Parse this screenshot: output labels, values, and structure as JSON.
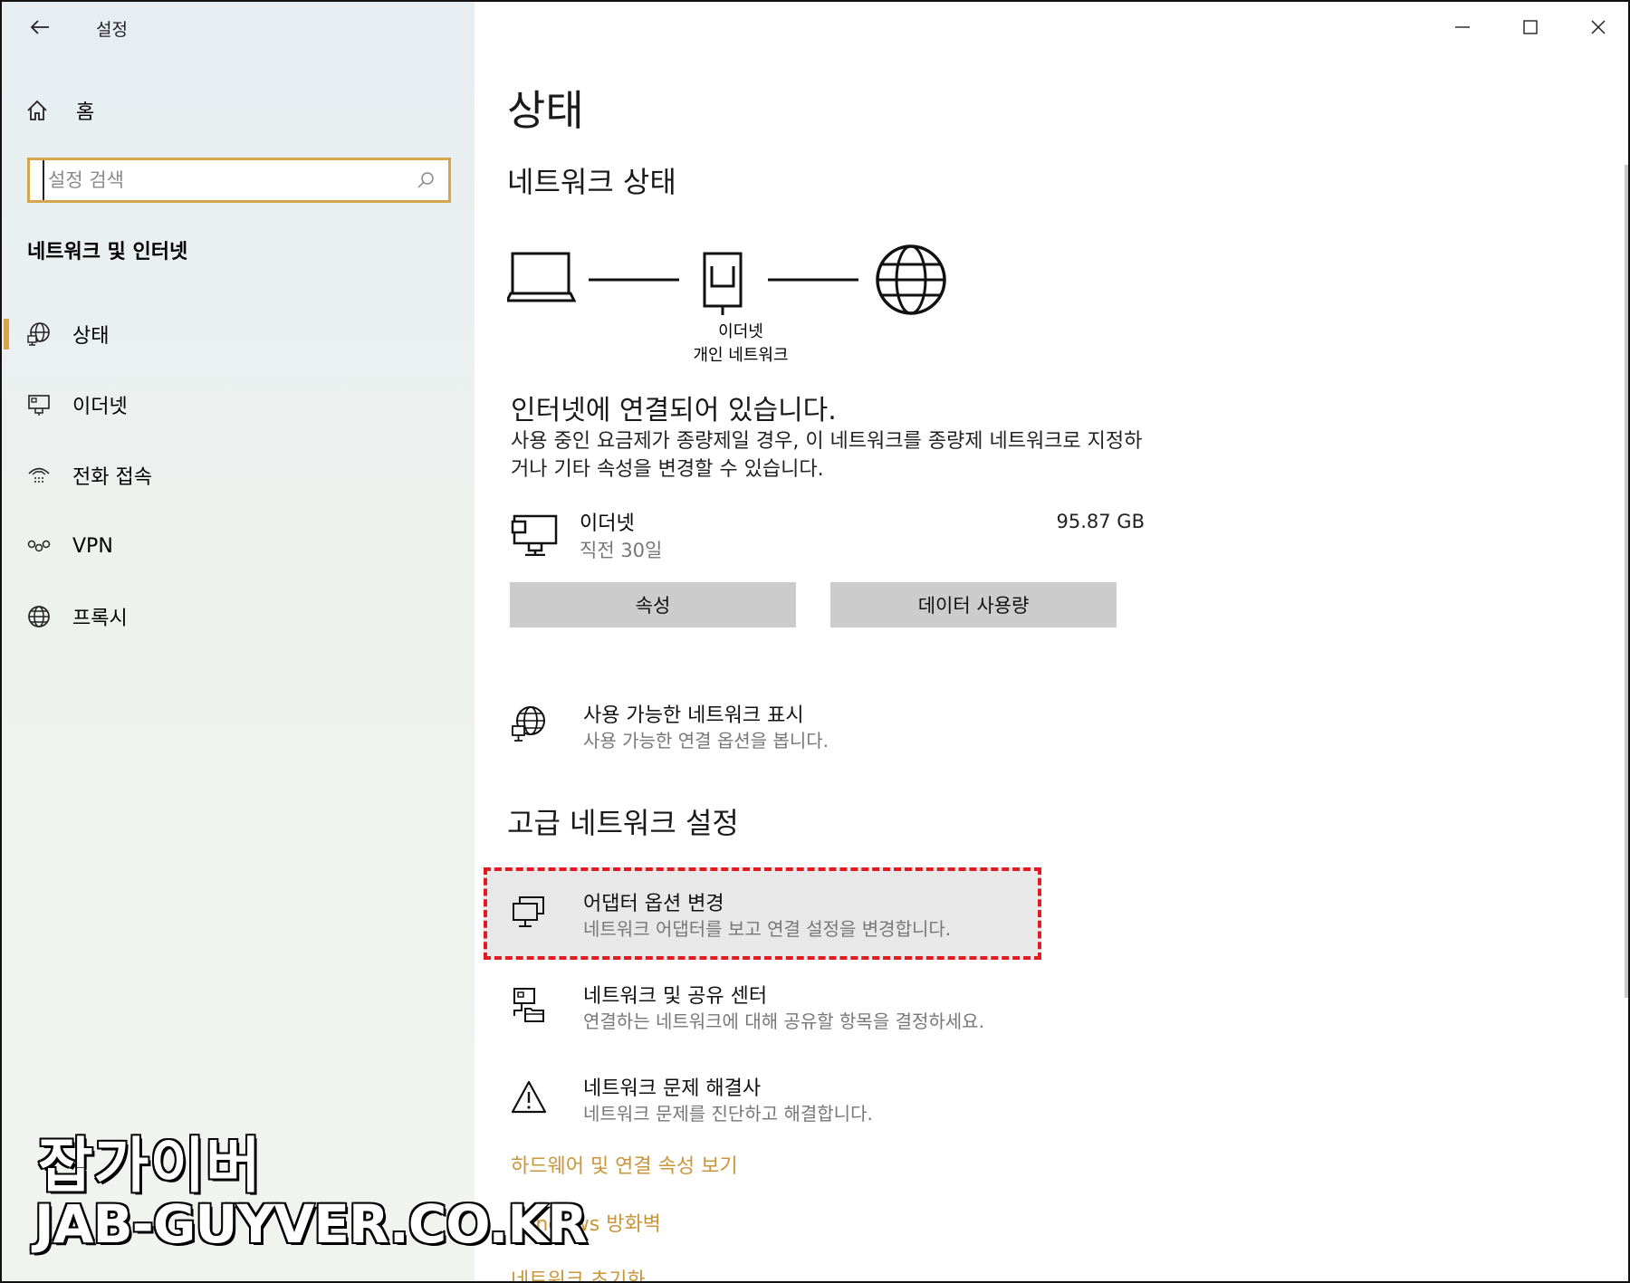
{
  "app": {
    "title": "설정"
  },
  "sidebar": {
    "home_label": "홈",
    "search_placeholder": "설정 검색",
    "section_title": "네트워크 및 인터넷",
    "items": [
      {
        "label": "상태",
        "icon": "globe-status-icon",
        "active": true
      },
      {
        "label": "이더넷",
        "icon": "ethernet-icon",
        "active": false
      },
      {
        "label": "전화 접속",
        "icon": "dialup-icon",
        "active": false
      },
      {
        "label": "VPN",
        "icon": "vpn-icon",
        "active": false
      },
      {
        "label": "프록시",
        "icon": "globe-icon",
        "active": false
      }
    ]
  },
  "main": {
    "page_title": "상태",
    "network_status_heading": "네트워크 상태",
    "diagram": {
      "adapter_label": "이더넷",
      "network_label": "개인 네트워크"
    },
    "connected_text": "인터넷에 연결되어 있습니다.",
    "description": "사용 중인 요금제가 종량제일 경우, 이 네트워크를 종량제 네트워크로 지정하거나 기타 속성을 변경할 수 있습니다.",
    "ethernet": {
      "name": "이더넷",
      "period": "직전 30일",
      "usage": "95.87 GB"
    },
    "buttons": {
      "properties": "속성",
      "data_usage": "데이터 사용량"
    },
    "show_networks": {
      "title": "사용 가능한 네트워크 표시",
      "subtitle": "사용 가능한 연결 옵션을 봅니다."
    },
    "advanced_heading": "고급 네트워크 설정",
    "adapter_options": {
      "title": "어댑터 옵션 변경",
      "subtitle": "네트워크 어댑터를 보고 연결 설정을 변경합니다."
    },
    "sharing_center": {
      "title": "네트워크 및 공유 센터",
      "subtitle": "연결하는 네트워크에 대해 공유할 항목을 결정하세요."
    },
    "troubleshooter": {
      "title": "네트워크 문제 해결사",
      "subtitle": "네트워크 문제를 진단하고 해결합니다."
    },
    "links": [
      "하드웨어 및 연결 속성 보기",
      "Windows 방화벽",
      "네트워크 초기화"
    ]
  },
  "watermark": {
    "line1": "잡가이버",
    "line2": "JAB-GUYVER.CO.KR"
  },
  "colors": {
    "accent": "#d6a44a",
    "link": "#c9963b",
    "highlight_border": "#e11b22",
    "button_bg": "#cccccc"
  }
}
